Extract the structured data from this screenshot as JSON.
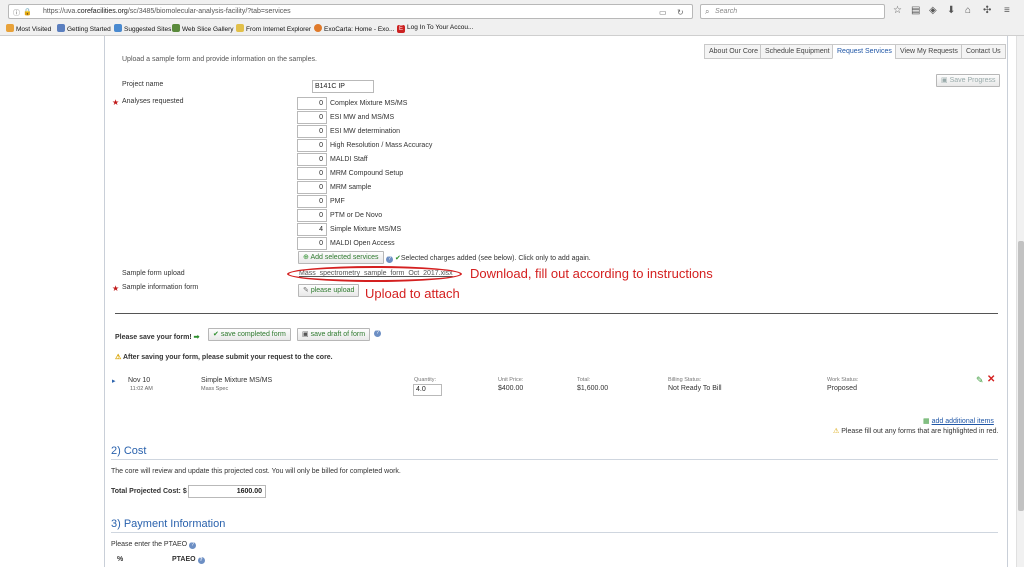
{
  "browser": {
    "url_prefix": "https://uva.",
    "url_domain": "corefacilities.org",
    "url_path": "/sc/3485/biomolecular-analysis-facility/?tab=services",
    "search_placeholder": "Search",
    "bookmarks": [
      "Most Visited",
      "Getting Started",
      "Suggested Sites",
      "Web Slice Gallery",
      "From Internet Explorer",
      "ExoCarta: Home - Exo...",
      "Log In To Your Accou..."
    ]
  },
  "tabs": [
    "About Our Core",
    "Schedule Equipment",
    "Request Services",
    "View My Requests",
    "Contact Us"
  ],
  "active_tab": "Request Services",
  "form": {
    "intro": "Upload a sample form and provide information on the samples.",
    "save_progress": "Save Progress",
    "project_name_label": "Project name",
    "project_name_value": "B141C IP",
    "analyses_label": "Analyses requested",
    "services": [
      {
        "qty": "0",
        "name": "Complex Mixture MS/MS"
      },
      {
        "qty": "0",
        "name": "ESI MW and MS/MS"
      },
      {
        "qty": "0",
        "name": "ESI MW determination"
      },
      {
        "qty": "0",
        "name": "High Resolution / Mass Accuracy"
      },
      {
        "qty": "0",
        "name": "MALDI Staff"
      },
      {
        "qty": "0",
        "name": "MRM Compound Setup"
      },
      {
        "qty": "0",
        "name": "MRM sample"
      },
      {
        "qty": "0",
        "name": "PMF"
      },
      {
        "qty": "0",
        "name": "PTM or De Novo"
      },
      {
        "qty": "4",
        "name": "Simple Mixture MS/MS"
      },
      {
        "qty": "0",
        "name": "MALDI Open Access"
      }
    ],
    "add_selected": "Add selected services",
    "charges_note": "Selected charges added (see below). Click only to add again.",
    "sample_upload_label": "Sample form upload",
    "sample_upload_link": "Mass_spectrometry_sample_form_Oct_2017.xlsx",
    "sample_info_label": "Sample information form",
    "please_upload": "please upload"
  },
  "annotations": {
    "download": "Download, fill out according to instructions",
    "upload": "Upload to attach"
  },
  "save": {
    "prompt": "Please save your form!",
    "save_completed": "save completed form",
    "save_draft": "save draft of form",
    "warning": "After saving your form, please submit your request to the core."
  },
  "item": {
    "date": "Nov 10",
    "time": "11:02 AM",
    "service": "Simple Mixture MS/MS",
    "category": "Mass Spec",
    "quantity_label": "Quantity:",
    "quantity": "4.0",
    "unit_price_label": "Unit Price:",
    "unit_price": "$400.00",
    "total_label": "Total:",
    "total": "$1,600.00",
    "billing_label": "Billing Status:",
    "billing": "Not Ready To Bill",
    "work_label": "Work Status:",
    "work": "Proposed"
  },
  "add_items": "add additional items",
  "forms_warning": "Please fill out any forms that are highlighted in red.",
  "cost": {
    "heading": "2) Cost",
    "note": "The core will review and update this projected cost. You will only be billed for completed work.",
    "total_label": "Total Projected Cost: $",
    "total_value": "1600.00"
  },
  "payment": {
    "heading": "3) Payment Information",
    "prompt": "Please enter the PTAEO",
    "col_pct": "%",
    "col_ptaeo": "PTAEO"
  }
}
